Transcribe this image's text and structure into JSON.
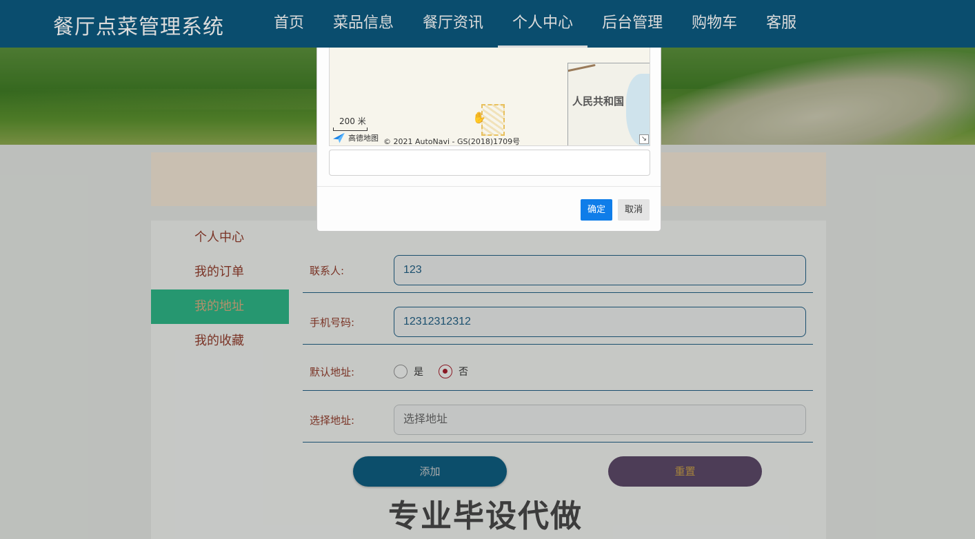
{
  "header": {
    "brand": "餐厅点菜管理系统",
    "nav": [
      "首页",
      "菜品信息",
      "餐厅资讯",
      "个人中心",
      "后台管理",
      "购物车",
      "客服"
    ]
  },
  "sidebar": {
    "items": [
      {
        "label": "个人中心",
        "active": false
      },
      {
        "label": "我的订单",
        "active": false
      },
      {
        "label": "我的地址",
        "active": true
      },
      {
        "label": "我的收藏",
        "active": false
      }
    ]
  },
  "form": {
    "contact_label": "联系人:",
    "contact_value": "123",
    "phone_label": "手机号码:",
    "phone_value": "12312312312",
    "default_label": "默认地址:",
    "radio_yes": "是",
    "radio_no": "否",
    "default_selected": "否",
    "address_label": "选择地址:",
    "address_placeholder": "选择地址",
    "add_button": "添加",
    "reset_button": "重置"
  },
  "modal": {
    "map": {
      "scale": "200 米",
      "logo_text": "高德地图",
      "copyright": "© 2021 AutoNavi - GS(2018)1709号",
      "inset_label": "人民共和国",
      "expand_icon": "↘"
    },
    "address_value": "",
    "ok_button": "确定",
    "cancel_button": "取消"
  },
  "watermark": "专业毕设代做",
  "colors": {
    "header_bg": "#0c5a80",
    "sidebar_active": "#2db083",
    "primary_button": "#0f7de9",
    "add_button": "#0e5b7d",
    "reset_button": "#5a4866"
  }
}
